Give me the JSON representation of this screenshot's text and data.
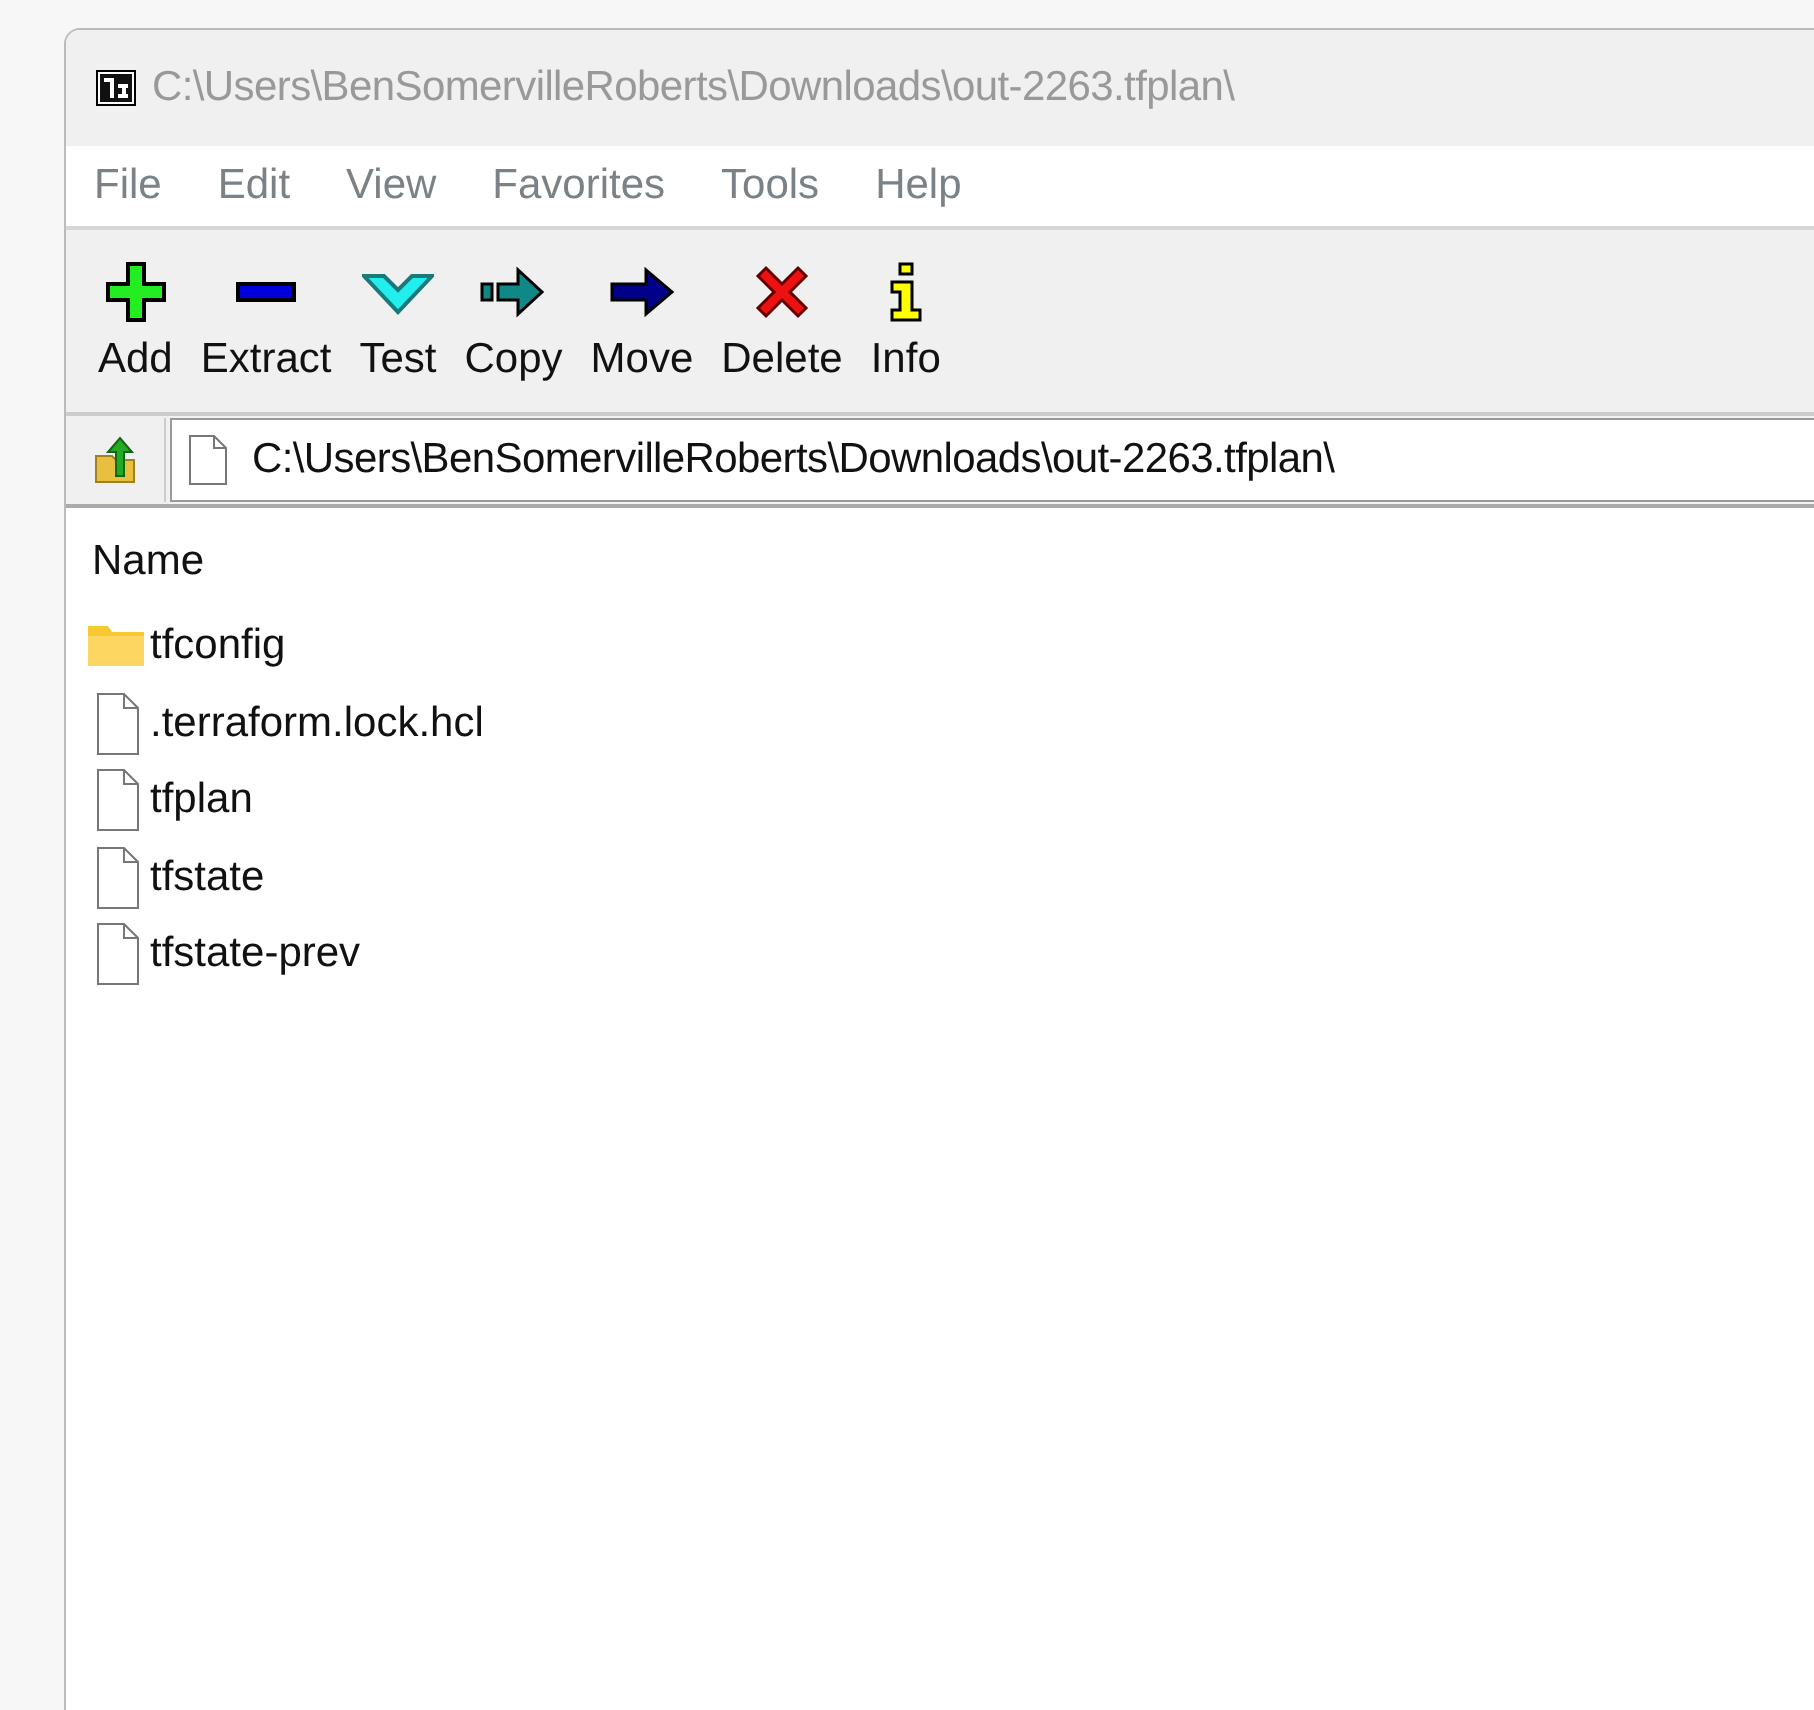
{
  "window": {
    "title": "C:\\Users\\BenSomervilleRoberts\\Downloads\\out-2263.tfplan\\"
  },
  "menu": [
    "File",
    "Edit",
    "View",
    "Favorites",
    "Tools",
    "Help"
  ],
  "toolbar": [
    {
      "kind": "add",
      "label": "Add"
    },
    {
      "kind": "extract",
      "label": "Extract"
    },
    {
      "kind": "test",
      "label": "Test"
    },
    {
      "kind": "copy",
      "label": "Copy"
    },
    {
      "kind": "move",
      "label": "Move"
    },
    {
      "kind": "delete",
      "label": "Delete"
    },
    {
      "kind": "info",
      "label": "Info"
    }
  ],
  "address": {
    "value": "C:\\Users\\BenSomervilleRoberts\\Downloads\\out-2263.tfplan\\"
  },
  "list": {
    "columns": [
      "Name"
    ],
    "rows": [
      {
        "kind": "folder",
        "name": "tfconfig"
      },
      {
        "kind": "file",
        "name": ".terraform.lock.hcl"
      },
      {
        "kind": "file",
        "name": "tfplan"
      },
      {
        "kind": "file",
        "name": "tfstate"
      },
      {
        "kind": "file",
        "name": "tfstate-prev"
      }
    ]
  }
}
